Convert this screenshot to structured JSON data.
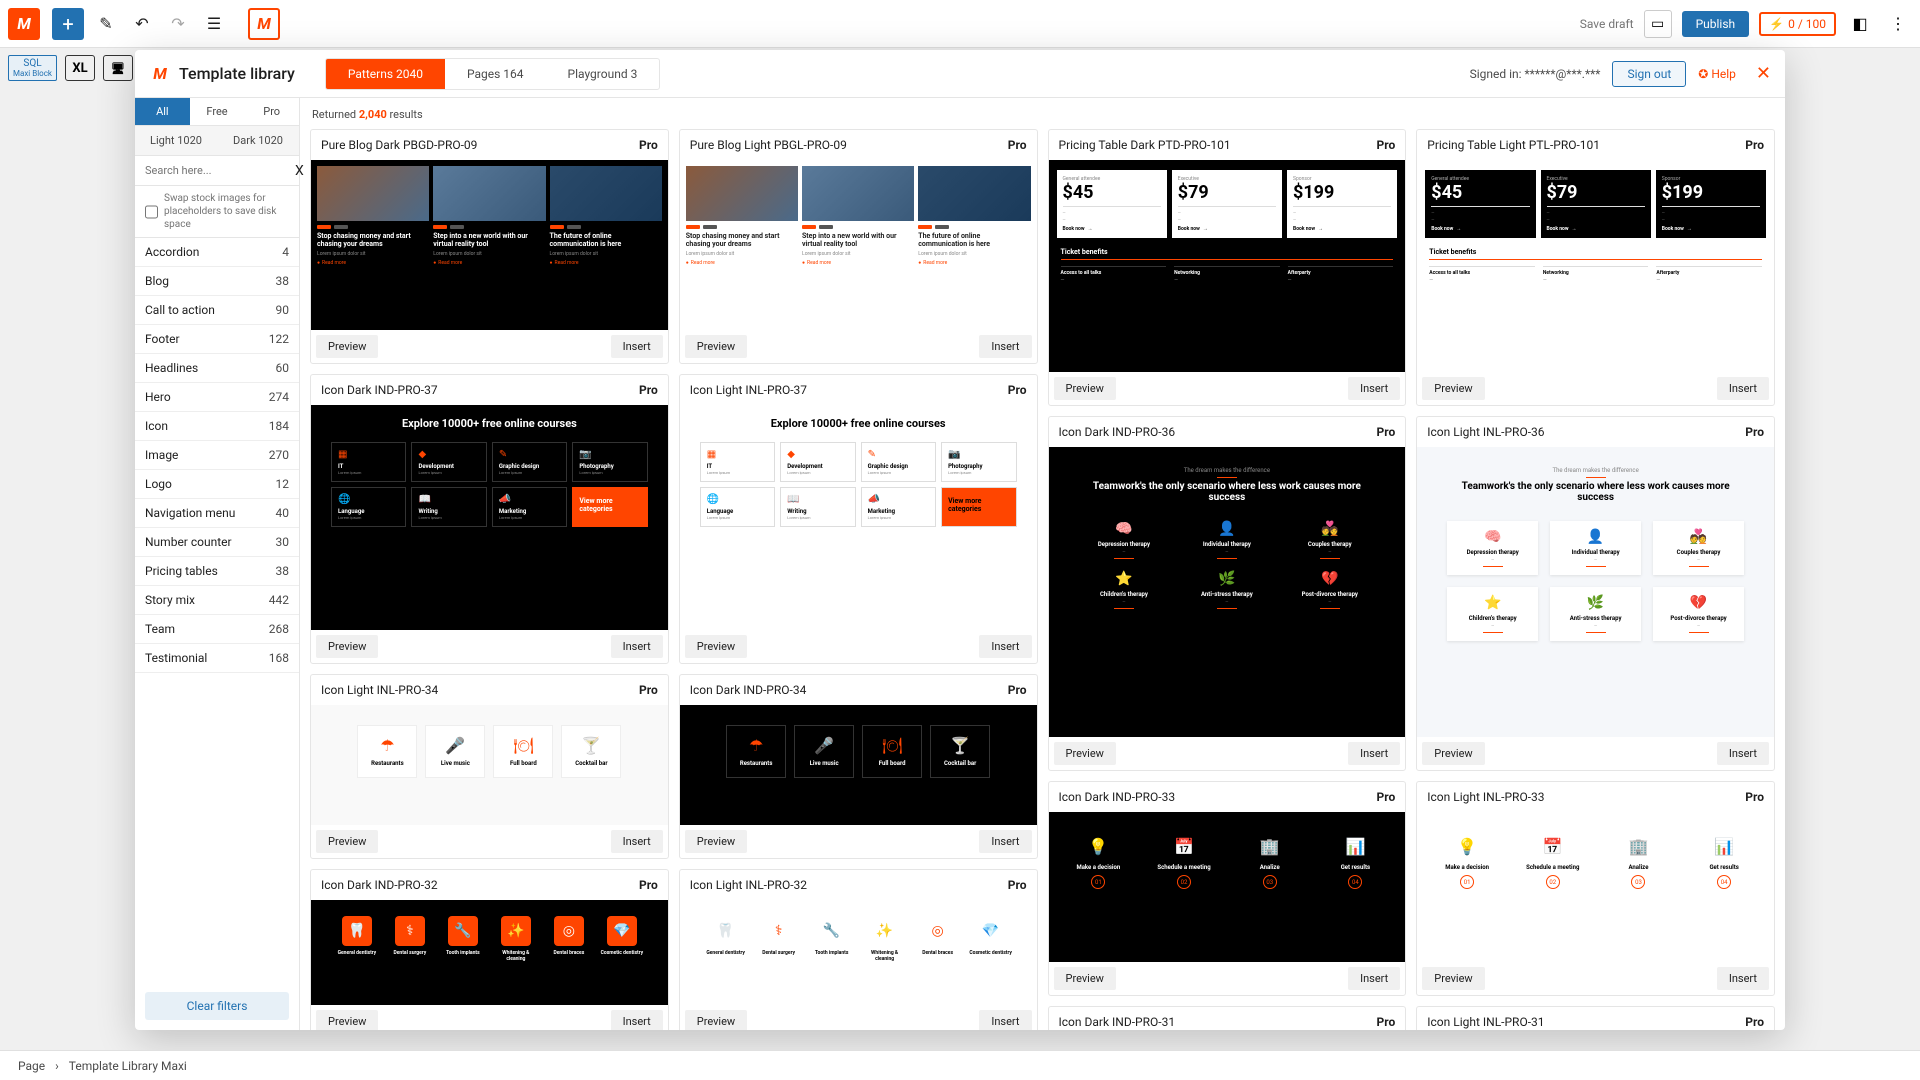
{
  "wp_toolbar": {
    "save_draft": "Save draft",
    "publish": "Publish",
    "usage": "0 / 100"
  },
  "sec_toolbar": {
    "block_label": "Maxi Block",
    "xl": "XL"
  },
  "modal": {
    "title": "Template library",
    "top_tabs": [
      {
        "label": "Patterns 2040",
        "active": true
      },
      {
        "label": "Pages 164",
        "active": false
      },
      {
        "label": "Playground 3",
        "active": false
      }
    ],
    "signed_in": "Signed in: ******@***.***",
    "sign_out": "Sign out",
    "help": "Help"
  },
  "sidebar": {
    "cost_tabs": [
      {
        "label": "All",
        "active": true
      },
      {
        "label": "Free",
        "active": false
      },
      {
        "label": "Pro",
        "active": false
      }
    ],
    "theme_tabs": [
      {
        "label": "Light 1020"
      },
      {
        "label": "Dark 1020"
      }
    ],
    "search": {
      "placeholder": "Search here...",
      "clear": "X"
    },
    "swap_label": "Swap stock images for placeholders to save disk space",
    "categories": [
      {
        "name": "Accordion",
        "count": "4"
      },
      {
        "name": "Blog",
        "count": "38"
      },
      {
        "name": "Call to action",
        "count": "90"
      },
      {
        "name": "Footer",
        "count": "122"
      },
      {
        "name": "Headlines",
        "count": "60"
      },
      {
        "name": "Hero",
        "count": "274"
      },
      {
        "name": "Icon",
        "count": "184"
      },
      {
        "name": "Image",
        "count": "270"
      },
      {
        "name": "Logo",
        "count": "12"
      },
      {
        "name": "Navigation menu",
        "count": "40"
      },
      {
        "name": "Number counter",
        "count": "30"
      },
      {
        "name": "Pricing tables",
        "count": "38"
      },
      {
        "name": "Story mix",
        "count": "442"
      },
      {
        "name": "Team",
        "count": "268"
      },
      {
        "name": "Testimonial",
        "count": "168"
      }
    ],
    "clear_filters": "Clear filters"
  },
  "results": {
    "returned": "Returned",
    "count": "2,040",
    "suffix": "results"
  },
  "buttons": {
    "preview": "Preview",
    "insert": "Insert"
  },
  "cards": {
    "c1": {
      "name": "Pure Blog Dark PBGD-PRO-09",
      "badge": "Pro"
    },
    "c2": {
      "name": "Pure Blog Light PBGL-PRO-09",
      "badge": "Pro"
    },
    "c3": {
      "name": "Pricing Table Dark PTD-PRO-101",
      "badge": "Pro"
    },
    "c4": {
      "name": "Pricing Table Light PTL-PRO-101",
      "badge": "Pro"
    },
    "c5": {
      "name": "Icon Dark IND-PRO-37",
      "badge": "Pro"
    },
    "c6": {
      "name": "Icon Light INL-PRO-37",
      "badge": "Pro"
    },
    "c7": {
      "name": "Icon Dark IND-PRO-36",
      "badge": "Pro"
    },
    "c8": {
      "name": "Icon Light INL-PRO-36",
      "badge": "Pro"
    },
    "c9": {
      "name": "Icon Light INL-PRO-34",
      "badge": "Pro"
    },
    "c10": {
      "name": "Icon Dark IND-PRO-34",
      "badge": "Pro"
    },
    "c11": {
      "name": "Icon Dark IND-PRO-33",
      "badge": "Pro"
    },
    "c12": {
      "name": "Icon Light INL-PRO-33",
      "badge": "Pro"
    },
    "c13": {
      "name": "Icon Dark IND-PRO-32",
      "badge": "Pro"
    },
    "c14": {
      "name": "Icon Light INL-PRO-32",
      "badge": "Pro"
    },
    "c15": {
      "name": "Icon Dark IND-PRO-31",
      "badge": "Pro"
    },
    "c16": {
      "name": "Icon Light INL-PRO-31",
      "badge": "Pro"
    }
  },
  "thumb_text": {
    "blog": {
      "h1": "Stop chasing money and start chasing your dreams",
      "h2": "Step into a new world with our virtual reality tool",
      "h3": "The future of online communication is here",
      "read": "Read more"
    },
    "pricing": {
      "tier1": "General attendee",
      "price1": "$45",
      "tier2": "Executive",
      "price2": "$79",
      "tier3": "Sponsor",
      "price3": "$199",
      "book": "Book now",
      "benefits": "Ticket benefits",
      "b1": "Access to all talks",
      "b2": "Networking",
      "b3": "Afterparty"
    },
    "courses": {
      "title": "Explore 10000+ free online courses",
      "i1": "IT",
      "i2": "Development",
      "i3": "Graphic design",
      "i4": "Photography",
      "i5": "Language",
      "i6": "Writing",
      "i7": "Marketing",
      "cta": "View more categories"
    },
    "teamwork": {
      "tag": "The dream makes the difference",
      "title": "Teamwork's the only scenario where less work causes more success",
      "t1": "Depression therapy",
      "t2": "Individual therapy",
      "t3": "Couples therapy",
      "t4": "Children's therapy",
      "t5": "Anti-stress therapy",
      "t6": "Post-divorce therapy"
    },
    "resto": {
      "r1": "Restaurants",
      "r2": "Live music",
      "r3": "Full board",
      "r4": "Cocktail bar"
    },
    "steps": {
      "s1": "Make a decision",
      "s2": "Schedule a meeting",
      "s3": "Analize",
      "s4": "Get results"
    },
    "dent": {
      "d1": "General dentistry",
      "d2": "Dental surgery",
      "d3": "Tooth implants",
      "d4": "Whitening & cleaning",
      "d5": "Dental braces",
      "d6": "Cosmetic dentistry"
    }
  },
  "breadcrumb": {
    "b1": "Page",
    "b2": "Template Library Maxi"
  }
}
